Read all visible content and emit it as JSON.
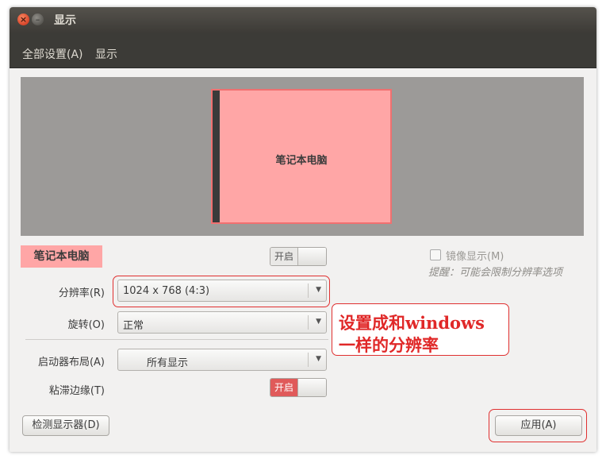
{
  "window": {
    "title": "显示"
  },
  "menu": {
    "items": [
      "全部设置(A)",
      "显示"
    ]
  },
  "preview": {
    "monitor_label": "笔记本电脑"
  },
  "display": {
    "name": "笔记本电脑",
    "power_toggle_label": "开启",
    "power_on": false
  },
  "mirror": {
    "label": "镜像显示(M)",
    "checked": false,
    "enabled": false
  },
  "hint": "提醒：可能会限制分辨率选项",
  "resolution": {
    "label": "分辨率(R)",
    "value": "1024 x 768 (4:3)"
  },
  "rotation": {
    "label": "旋转(O)",
    "value": "正常"
  },
  "launcher": {
    "label": "启动器布局(A)",
    "value": "所有显示"
  },
  "sticky": {
    "label": "粘滞边缘(T)",
    "toggle_label": "开启",
    "on": true
  },
  "buttons": {
    "detect": "检测显示器(D)",
    "apply": "应用(A)"
  },
  "annotation": {
    "line1": "设置成和windows",
    "line2": "一样的分辨率"
  },
  "colors": {
    "accent": "#e05a5a",
    "annotation": "#e02828",
    "monitor_fill": "#ffa6a6"
  }
}
